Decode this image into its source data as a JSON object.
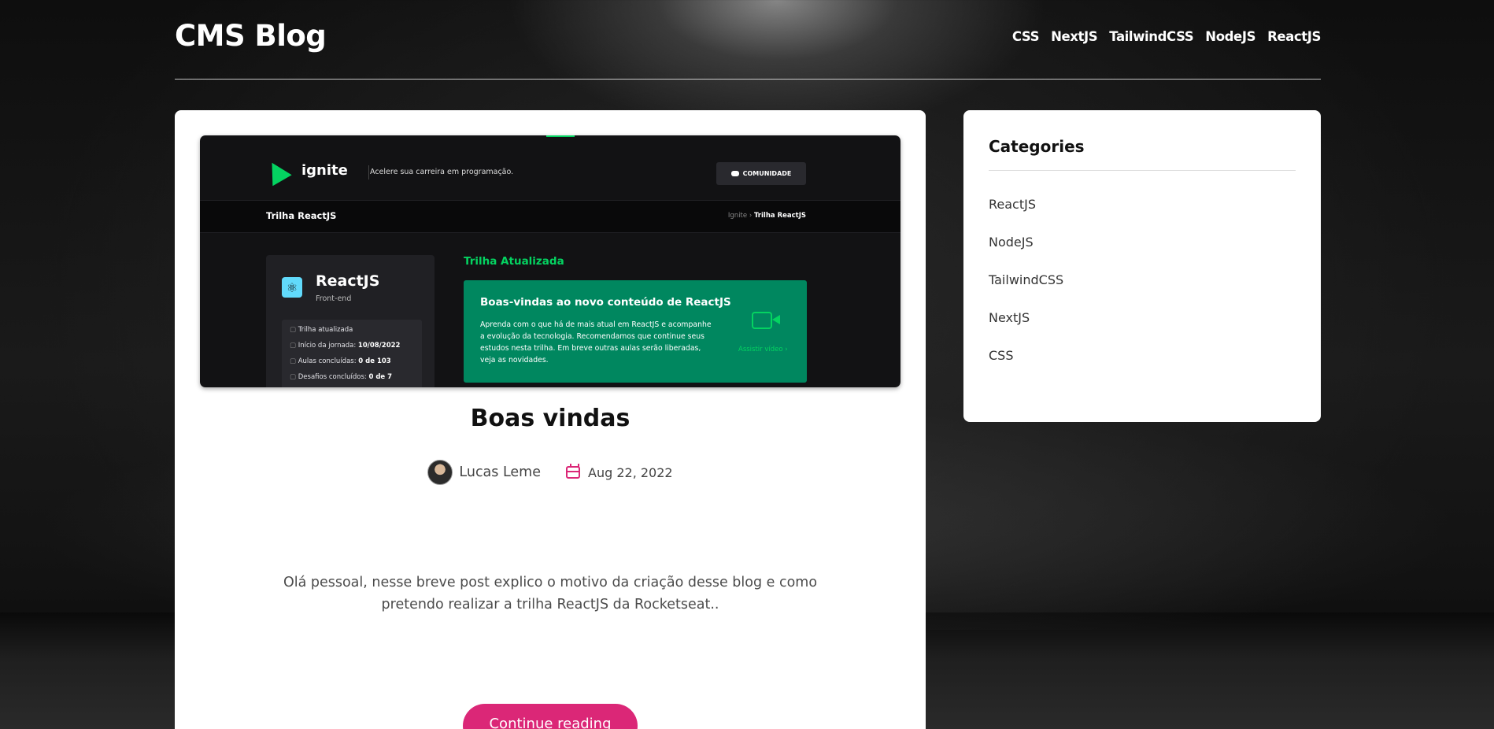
{
  "header": {
    "brand": "CMS Blog",
    "nav": [
      "CSS",
      "NextJS",
      "TailwindCSS",
      "NodeJS",
      "ReactJS"
    ]
  },
  "post": {
    "hero": {
      "logo_text": "ignite",
      "tagline": "Acelere sua carreira em programação.",
      "community_button": "COMUNIDADE",
      "trail_title": "Trilha ReactJS",
      "breadcrumb_home": "Ignite",
      "breadcrumb_current": "Trilha ReactJS",
      "card_title": "ReactJS",
      "card_subtitle": "Front-end",
      "card_items": [
        {
          "label": "Trilha atualizada",
          "value": ""
        },
        {
          "label": "Início da jornada: ",
          "value": "10/08/2022"
        },
        {
          "label": "Aulas concluídas: ",
          "value": "0 de 103"
        },
        {
          "label": "Desafios concluídos: ",
          "value": "0 de 7"
        }
      ],
      "updated_label": "Trilha Atualizada",
      "welcome_title": "Boas-vindas ao novo conteúdo de ReactJS",
      "welcome_text": "Aprenda com o que há de mais atual em ReactJS e acompanhe a evolução da tecnologia. Recomendamos que continue seus estudos nesta trilha. Em breve outras aulas serão liberadas, veja as novidades.",
      "watch_video": "Assistir vídeo  ›"
    },
    "title": "Boas vindas",
    "author": "Lucas Leme",
    "date": "Aug 22, 2022",
    "excerpt": "Olá pessoal, nesse breve post explico o motivo da criação desse blog e como pretendo realizar a trilha ReactJS da Rocketseat..",
    "cta": "Continue reading"
  },
  "categories": {
    "title": "Categories",
    "items": [
      "ReactJS",
      "NodeJS",
      "TailwindCSS",
      "NextJS",
      "CSS"
    ]
  },
  "colors": {
    "accent": "#db2777",
    "ignite_green": "#04d361"
  }
}
